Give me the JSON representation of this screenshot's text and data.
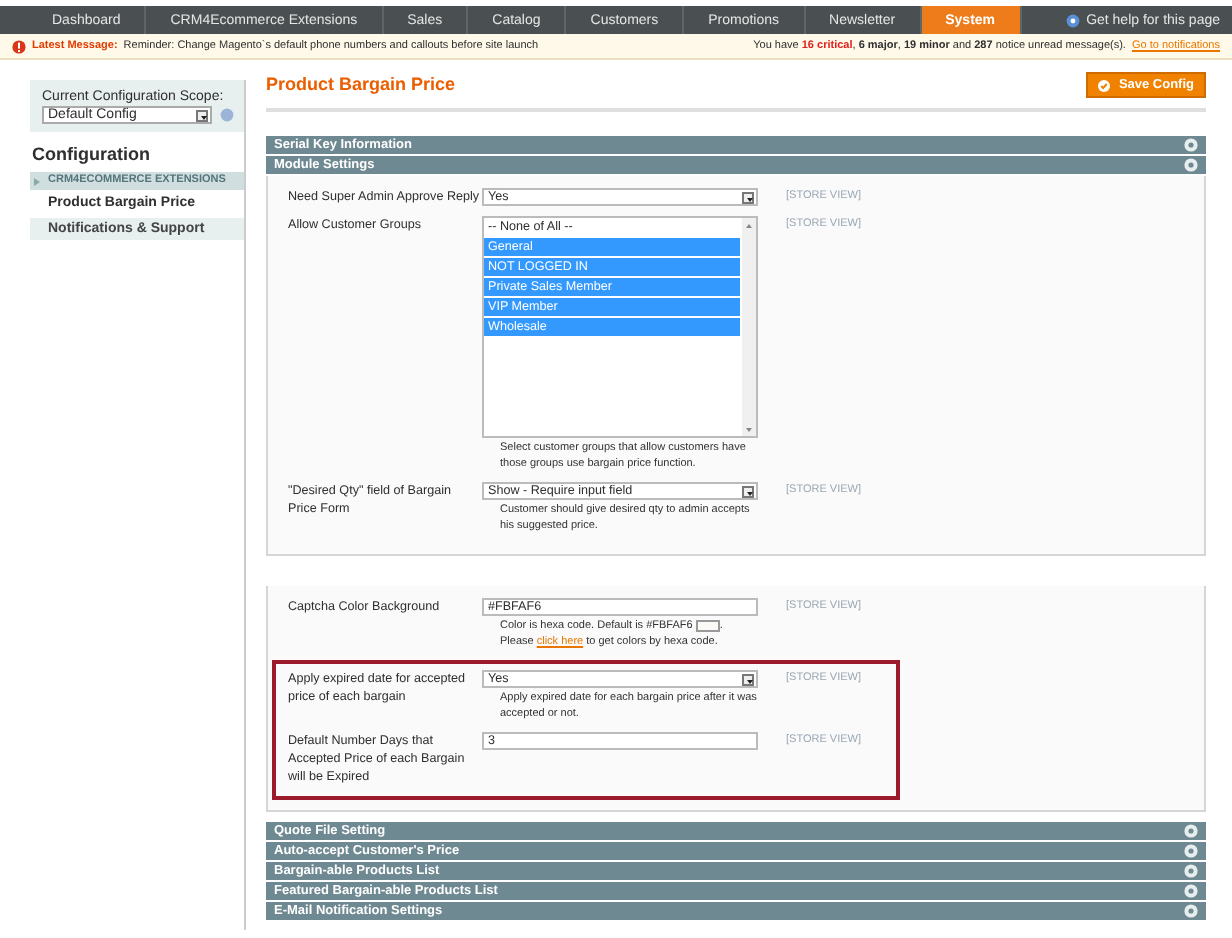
{
  "nav": {
    "items": [
      {
        "label": "Dashboard",
        "selected": false
      },
      {
        "label": "CRM4Ecommerce Extensions",
        "selected": false
      },
      {
        "label": "Sales",
        "selected": false
      },
      {
        "label": "Catalog",
        "selected": false
      },
      {
        "label": "Customers",
        "selected": false
      },
      {
        "label": "Promotions",
        "selected": false
      },
      {
        "label": "Newsletter",
        "selected": false
      },
      {
        "label": "System",
        "selected": true
      }
    ],
    "help": "Get help for this page"
  },
  "message": {
    "label": "Latest Message:",
    "text": "Reminder: Change Magento`s default phone numbers and callouts before site launch",
    "notice": "You have **16 critical**, **6 major**, **19 minor** and **287** notice unread message(s).",
    "link": "Go to notifications"
  },
  "sidebar": {
    "scope_label": "Current Configuration Scope:",
    "scope_value": "Default Config",
    "heading": "Configuration",
    "groups": [
      {
        "title": "CRM4ECOMMERCE EXTENSIONS",
        "items": [
          {
            "label": "Product Bargain Price",
            "selected": true
          }
        ]
      },
      {
        "title": "Notifications & Support"
      }
    ]
  },
  "page_title": "Product Bargain Price",
  "save_button": "Save Config",
  "top_sections": [
    "Serial Key Information"
  ],
  "module_settings": {
    "title": "Module Settings",
    "panels": [
      {
        "groups": [
          {
            "highlighted": false,
            "rows": [
              {
                "kind": "select",
                "label": "Need Super Admin Approve Reply",
                "value": "Yes",
                "scope": "[STORE VIEW]"
              },
              {
                "kind": "multiselect",
                "label": "Allow Customer Groups",
                "options": [
                  {
                    "label": "-- None of All --",
                    "selected": false
                  },
                  {
                    "label": "General",
                    "selected": true
                  },
                  {
                    "label": "NOT LOGGED IN",
                    "selected": true
                  },
                  {
                    "label": "Private Sales Member",
                    "selected": true
                  },
                  {
                    "label": "VIP Member",
                    "selected": true
                  },
                  {
                    "label": "Wholesale",
                    "selected": true
                  }
                ],
                "hint": "Select customer groups that allow customers have those groups use bargain price function.",
                "scope": "[STORE VIEW]"
              },
              {
                "kind": "select",
                "label": "\"Desired Qty\" field of Bargain Price Form",
                "value": "Show - Require input field",
                "hint": "Customer should give desired qty to admin accepts his suggested price.",
                "scope": "[STORE VIEW]"
              }
            ]
          }
        ]
      },
      {
        "groups": [
          {
            "highlighted": false,
            "rows": [
              {
                "kind": "text",
                "label": "Captcha Color Background",
                "value": "#FBFAF6",
                "hint_before": "Color is hexa code. Default is #FBFAF6",
                "hint_mid": ". Please",
                "hint_link": "click here",
                "hint_after": "to get colors by hexa code.",
                "scope": "[STORE VIEW]"
              }
            ]
          },
          {
            "highlighted": true,
            "rows": [
              {
                "kind": "select",
                "label": "Apply expired date for accepted price of each bargain",
                "value": "Yes",
                "hint": "Apply expired date for each bargain price after it was accepted or not.",
                "scope": "[STORE VIEW]"
              },
              {
                "kind": "text",
                "label": "Default Number Days that Accepted Price of each Bargain will be Expired",
                "value": "3",
                "scope": "[STORE VIEW]"
              }
            ]
          }
        ]
      }
    ]
  },
  "bottom_sections": [
    "Quote File Setting",
    "Auto-accept Customer's Price",
    "Bargain-able Products List",
    "Featured Bargain-able Products List",
    "E-Mail Notification Settings"
  ]
}
